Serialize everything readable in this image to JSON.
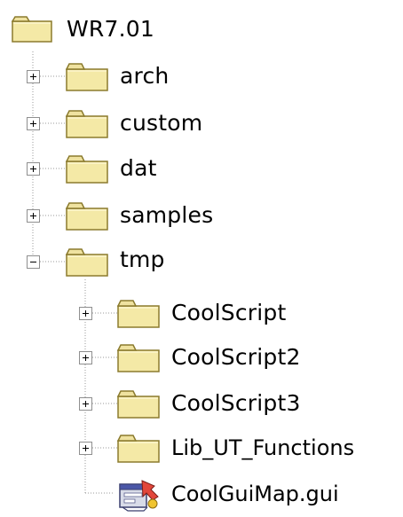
{
  "tree": {
    "root": {
      "label": "WR7.01",
      "icon": "folder-icon",
      "expanded": true
    },
    "children": [
      {
        "label": "arch",
        "icon": "folder-icon",
        "expanded": false
      },
      {
        "label": "custom",
        "icon": "folder-icon",
        "expanded": false
      },
      {
        "label": "dat",
        "icon": "folder-icon",
        "expanded": false
      },
      {
        "label": "samples",
        "icon": "folder-icon",
        "expanded": false
      },
      {
        "label": "tmp",
        "icon": "folder-icon",
        "expanded": true,
        "children": [
          {
            "label": "CoolScript",
            "icon": "folder-icon",
            "expanded": false
          },
          {
            "label": "CoolScript2",
            "icon": "folder-icon",
            "expanded": false
          },
          {
            "label": "CoolScript3",
            "icon": "folder-icon",
            "expanded": false
          },
          {
            "label": "Lib_UT_Functions",
            "icon": "folder-icon",
            "expanded": false
          },
          {
            "label": "CoolGuiMap.gui",
            "icon": "gui-map-file-icon"
          }
        ]
      }
    ]
  },
  "colors": {
    "folder_fill": "#f4e9a6",
    "folder_tab": "#efe2a0",
    "folder_outline": "#8b7b2e",
    "tree_line": "#9a9a9a"
  }
}
